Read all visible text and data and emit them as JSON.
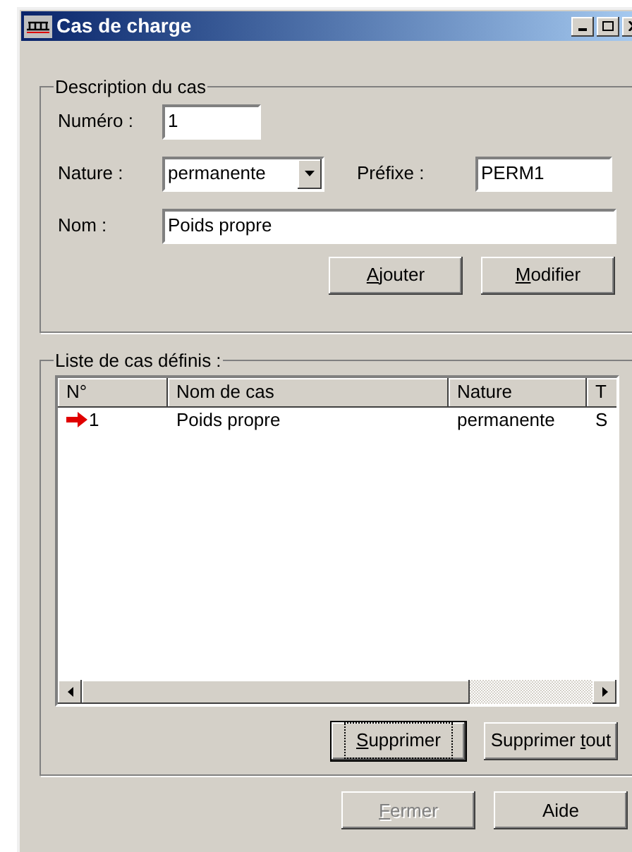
{
  "window": {
    "title": "Cas de charge"
  },
  "description": {
    "title": "Description du cas",
    "numero": {
      "label": "Numéro :",
      "value": "1"
    },
    "nature": {
      "label": "Nature :",
      "value": "permanente"
    },
    "prefixe": {
      "label": "Préfixe :",
      "value": "PERM1"
    },
    "nom": {
      "label": "Nom :",
      "value": "Poids propre"
    },
    "buttons": [
      {
        "key": "A",
        "post": "jouter",
        "disabled": false,
        "focused": false
      },
      {
        "key": "M",
        "post": "odifier",
        "disabled": false,
        "focused": false
      }
    ]
  },
  "list": {
    "title": "Liste de cas définis :",
    "columns": [
      "N°",
      "Nom de cas",
      "Nature",
      "T"
    ],
    "rows": [
      {
        "current": true,
        "cells": [
          "1",
          "Poids propre",
          "permanente",
          "S"
        ]
      }
    ],
    "buttons": [
      {
        "key": "S",
        "post": "upprimer",
        "disabled": false,
        "focused": true
      },
      {
        "pre": "Supprimer ",
        "key": "t",
        "post": "out",
        "disabled": false,
        "focused": false
      }
    ]
  },
  "footer_buttons": [
    {
      "key": "F",
      "post": "ermer",
      "disabled": true,
      "focused": false
    },
    {
      "pre": "Aide",
      "disabled": false,
      "focused": false
    }
  ]
}
